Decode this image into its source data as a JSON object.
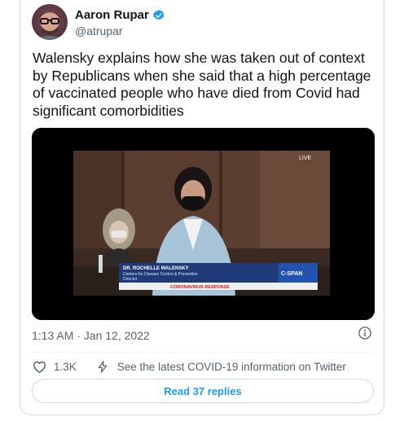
{
  "author": {
    "display_name": "Aaron Rupar",
    "handle": "@atrupar",
    "verified": true,
    "avatar_icon": "avatar-photo"
  },
  "tweet": {
    "text": "Walensky explains how she was taken out of context by Republicans when she said that a high percentage of vaccinated people who have died from Covid had significant comorbidities",
    "timestamp": "1:13 AM · Jan 12, 2022"
  },
  "video": {
    "live_badge": "LIVE",
    "lower_third": {
      "name": "DR. ROCHELLE WALENSKY",
      "title_line1": "Centers for Disease Control & Prevention",
      "title_line2": "Director",
      "banner": "CORONAVIRUS RESPONSE"
    },
    "network_logo": "C-SPAN"
  },
  "actions": {
    "like_icon": "heart-icon",
    "like_count": "1.3K",
    "covid_icon": "lightning-icon",
    "covid_text": "See the latest COVID-19 information on Twitter"
  },
  "replies_button": "Read 37 replies",
  "colors": {
    "accent": "#1d9bf0",
    "secondary_text": "#536471",
    "border": "#cfd9de"
  }
}
